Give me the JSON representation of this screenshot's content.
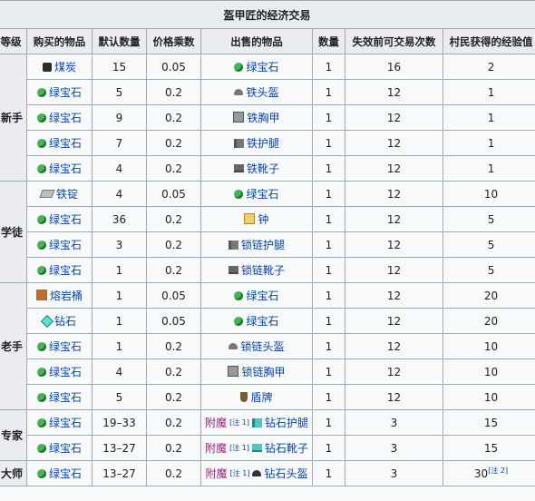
{
  "caption": "盔甲匠的经济交易",
  "headers": [
    "等级",
    "购买的物品",
    "默认数量",
    "价格乘数",
    "出售的物品",
    "数量",
    "失效前可交易次数",
    "村民获得的经验值"
  ],
  "rows": [
    {
      "level": "",
      "level_span": 0,
      "buy": "煤炭",
      "buy_icon": "coal-icon",
      "qty": "15",
      "mult": "0.05",
      "sell_prefix": "",
      "sell": "绿宝石",
      "sell_icon": "emerald-icon",
      "sell_qty": "1",
      "uses": "16",
      "xp": "2"
    },
    {
      "level": "新手",
      "level_span": 0,
      "buy": "绿宝石",
      "buy_icon": "emerald-icon",
      "qty": "5",
      "mult": "0.2",
      "sell_prefix": "",
      "sell": "铁头盔",
      "sell_icon": "iron-helmet-icon",
      "sell_qty": "1",
      "uses": "12",
      "xp": "1"
    },
    {
      "level": "",
      "level_span": 0,
      "buy": "绿宝石",
      "buy_icon": "emerald-icon",
      "qty": "9",
      "mult": "0.2",
      "sell_prefix": "",
      "sell": "铁胸甲",
      "sell_icon": "iron-chestplate-icon",
      "sell_qty": "1",
      "uses": "12",
      "xp": "1"
    },
    {
      "level": "",
      "level_span": 0,
      "buy": "绿宝石",
      "buy_icon": "emerald-icon",
      "qty": "7",
      "mult": "0.2",
      "sell_prefix": "",
      "sell": "铁护腿",
      "sell_icon": "iron-leggings-icon",
      "sell_qty": "1",
      "uses": "12",
      "xp": "1"
    },
    {
      "level": "",
      "level_span": 0,
      "buy": "绿宝石",
      "buy_icon": "emerald-icon",
      "qty": "4",
      "mult": "0.2",
      "sell_prefix": "",
      "sell": "铁靴子",
      "sell_icon": "iron-boots-icon",
      "sell_qty": "1",
      "uses": "12",
      "xp": "1"
    },
    {
      "level": "",
      "level_span": 0,
      "buy": "铁锭",
      "buy_icon": "iron-ingot-icon",
      "qty": "4",
      "mult": "0.05",
      "sell_prefix": "",
      "sell": "绿宝石",
      "sell_icon": "emerald-icon",
      "sell_qty": "1",
      "uses": "12",
      "xp": "10"
    },
    {
      "level": "学徒",
      "level_span": 0,
      "buy": "绿宝石",
      "buy_icon": "emerald-icon",
      "qty": "36",
      "mult": "0.2",
      "sell_prefix": "",
      "sell": "钟",
      "sell_icon": "bell-icon",
      "sell_qty": "1",
      "uses": "12",
      "xp": "5"
    },
    {
      "level": "",
      "level_span": 0,
      "buy": "绿宝石",
      "buy_icon": "emerald-icon",
      "qty": "3",
      "mult": "0.2",
      "sell_prefix": "",
      "sell": "锁链护腿",
      "sell_icon": "chain-leggings-icon",
      "sell_qty": "1",
      "uses": "12",
      "xp": "5"
    },
    {
      "level": "",
      "level_span": 0,
      "buy": "绿宝石",
      "buy_icon": "emerald-icon",
      "qty": "1",
      "mult": "0.2",
      "sell_prefix": "",
      "sell": "锁链靴子",
      "sell_icon": "chain-boots-icon",
      "sell_qty": "1",
      "uses": "12",
      "xp": "5"
    },
    {
      "level": "",
      "level_span": 0,
      "buy": "熔岩桶",
      "buy_icon": "lava-bucket-icon",
      "qty": "1",
      "mult": "0.05",
      "sell_prefix": "",
      "sell": "绿宝石",
      "sell_icon": "emerald-icon",
      "sell_qty": "1",
      "uses": "12",
      "xp": "20"
    },
    {
      "level": "",
      "level_span": 0,
      "buy": "钻石",
      "buy_icon": "diamond-icon",
      "qty": "1",
      "mult": "0.05",
      "sell_prefix": "",
      "sell": "绿宝石",
      "sell_icon": "emerald-icon",
      "sell_qty": "1",
      "uses": "12",
      "xp": "20"
    },
    {
      "level": "老手",
      "level_span": 0,
      "buy": "绿宝石",
      "buy_icon": "emerald-icon",
      "qty": "1",
      "mult": "0.2",
      "sell_prefix": "",
      "sell": "锁链头盔",
      "sell_icon": "chain-helmet-icon",
      "sell_qty": "1",
      "uses": "12",
      "xp": "10"
    },
    {
      "level": "",
      "level_span": 0,
      "buy": "绿宝石",
      "buy_icon": "emerald-icon",
      "qty": "4",
      "mult": "0.2",
      "sell_prefix": "",
      "sell": "锁链胸甲",
      "sell_icon": "chain-chestplate-icon",
      "sell_qty": "1",
      "uses": "12",
      "xp": "10"
    },
    {
      "level": "",
      "level_span": 0,
      "buy": "绿宝石",
      "buy_icon": "emerald-icon",
      "qty": "5",
      "mult": "0.2",
      "sell_prefix": "",
      "sell": "盾牌",
      "sell_icon": "shield-icon",
      "sell_qty": "1",
      "uses": "12",
      "xp": "10"
    },
    {
      "level": "专家",
      "level_span": 0,
      "buy": "绿宝石",
      "buy_icon": "emerald-icon",
      "qty": "19–33",
      "mult": "0.2",
      "sell_prefix": "附魔",
      "sell_note": "[注 1]",
      "sell": "钻石护腿",
      "sell_icon": "diamond-leggings-icon",
      "sell_qty": "1",
      "uses": "3",
      "xp": "15"
    },
    {
      "level": "",
      "level_span": 0,
      "buy": "绿宝石",
      "buy_icon": "emerald-icon",
      "qty": "13–27",
      "mult": "0.2",
      "sell_prefix": "附魔",
      "sell_note": "[注 1]",
      "sell": "钻石靴子",
      "sell_icon": "diamond-boots-icon",
      "sell_qty": "1",
      "uses": "3",
      "xp": "15"
    },
    {
      "level": "大师",
      "level_span": 0,
      "buy": "绿宝石",
      "buy_icon": "emerald-icon",
      "qty": "13–27",
      "mult": "0.2",
      "sell_prefix": "附魔",
      "sell_note": "[注 1]",
      "sell": "钻石头盔",
      "sell_icon": "diamond-helmet-icon",
      "sell_qty": "1",
      "uses": "3",
      "xp": "30",
      "xp_note": "[注 2]"
    }
  ]
}
